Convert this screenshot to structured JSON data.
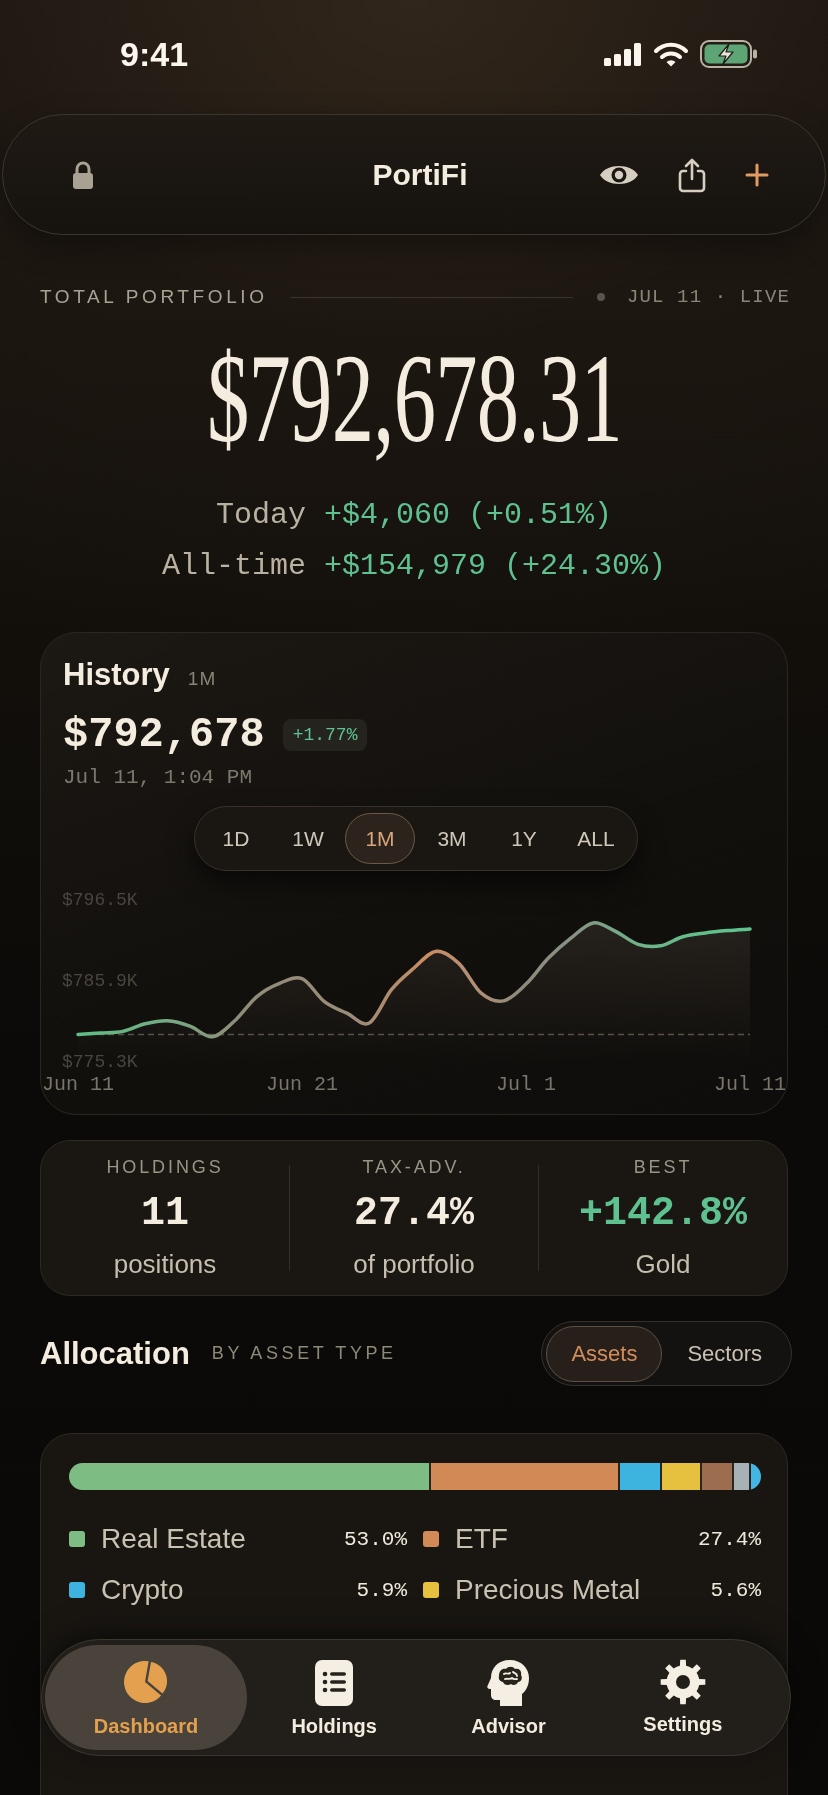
{
  "status_bar": {
    "time": "9:41"
  },
  "header": {
    "title": "PortiFi"
  },
  "summary": {
    "label": "TOTAL PORTFOLIO",
    "date": "JUL 11 · LIVE",
    "total": "$792,678.31",
    "changes": [
      {
        "label": "Today",
        "value": "+$4,060 (+0.51%)"
      },
      {
        "label": "All-time",
        "value": "+$154,979 (+24.30%)"
      }
    ]
  },
  "history": {
    "title": "History",
    "period": "1M",
    "value": "$792,678",
    "change": "+1.77%",
    "timestamp": "Jul 11, 1:04 PM",
    "ranges": [
      {
        "label": "1D",
        "selected": false
      },
      {
        "label": "1W",
        "selected": false
      },
      {
        "label": "1M",
        "selected": true
      },
      {
        "label": "3M",
        "selected": false
      },
      {
        "label": "1Y",
        "selected": false
      },
      {
        "label": "ALL",
        "selected": false
      }
    ],
    "chart_data": {
      "type": "area",
      "categories": [
        "Jun 11",
        null,
        null,
        null,
        null,
        null,
        null,
        null,
        null,
        null,
        "Jun 21",
        null,
        null,
        null,
        null,
        null,
        null,
        null,
        null,
        null,
        "Jul 1",
        null,
        null,
        null,
        null,
        null,
        null,
        null,
        null,
        null,
        "Jul 11"
      ],
      "values": [
        778.9,
        779.1,
        779.3,
        780.3,
        780.7,
        780.0,
        778.6,
        780.7,
        783.9,
        785.6,
        786.2,
        783.2,
        781.7,
        780.4,
        784.8,
        787.6,
        789.8,
        788.2,
        784.3,
        783.3,
        785.5,
        788.9,
        791.5,
        793.5,
        792.4,
        790.7,
        790.5,
        791.7,
        792.2,
        792.5,
        792.7
      ],
      "ylim": [
        775.3,
        796.5
      ],
      "yticks": [
        {
          "value": 796.5,
          "label": "$796.5K"
        },
        {
          "value": 785.9,
          "label": "$785.9K"
        },
        {
          "value": 775.3,
          "label": "$775.3K"
        }
      ],
      "ref_lines": [
        {
          "axis": "y",
          "value": 778.9
        }
      ]
    }
  },
  "stats": [
    {
      "label": "HOLDINGS",
      "value": "11",
      "caption": "positions",
      "positive": false
    },
    {
      "label": "TAX-ADV.",
      "value": "27.4%",
      "caption": "of portfolio",
      "positive": false
    },
    {
      "label": "BEST",
      "value": "+142.8%",
      "caption": "Gold",
      "positive": true
    }
  ],
  "allocation": {
    "title": "Allocation",
    "subtitle": "BY ASSET TYPE",
    "views": [
      {
        "label": "Assets",
        "selected": true
      },
      {
        "label": "Sectors",
        "selected": false
      }
    ],
    "bar": [
      {
        "color": "#7dbd84"
      },
      {
        "color": "#d18a56"
      },
      {
        "color": "#3db4df"
      },
      {
        "color": "#e6c03f"
      },
      {
        "color": "#9c6e4f"
      },
      {
        "color": "#a7b1b6"
      },
      {
        "color": "#44b6e6"
      }
    ],
    "legend": [
      {
        "label": "Real Estate",
        "value": "53.0%",
        "color": "#7dbd84"
      },
      {
        "label": "ETF",
        "value": "27.4%",
        "color": "#d18a56"
      },
      {
        "label": "Crypto",
        "value": "5.9%",
        "color": "#3db4df"
      },
      {
        "label": "Precious Metal",
        "value": "5.6%",
        "color": "#e6c03f"
      }
    ]
  },
  "tab_bar": [
    {
      "label": "Dashboard",
      "selected": true
    },
    {
      "label": "Holdings",
      "selected": false
    },
    {
      "label": "Advisor",
      "selected": false
    },
    {
      "label": "Settings",
      "selected": false
    }
  ]
}
